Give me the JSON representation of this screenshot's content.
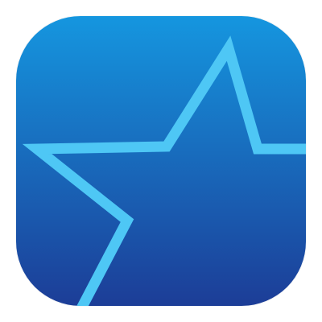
{
  "app_icon": {
    "icon": "star-outline-icon",
    "colors": {
      "gradient_top": "#1596df",
      "gradient_bottom": "#1c3d97",
      "star_stroke": "#4ec7f5"
    }
  }
}
